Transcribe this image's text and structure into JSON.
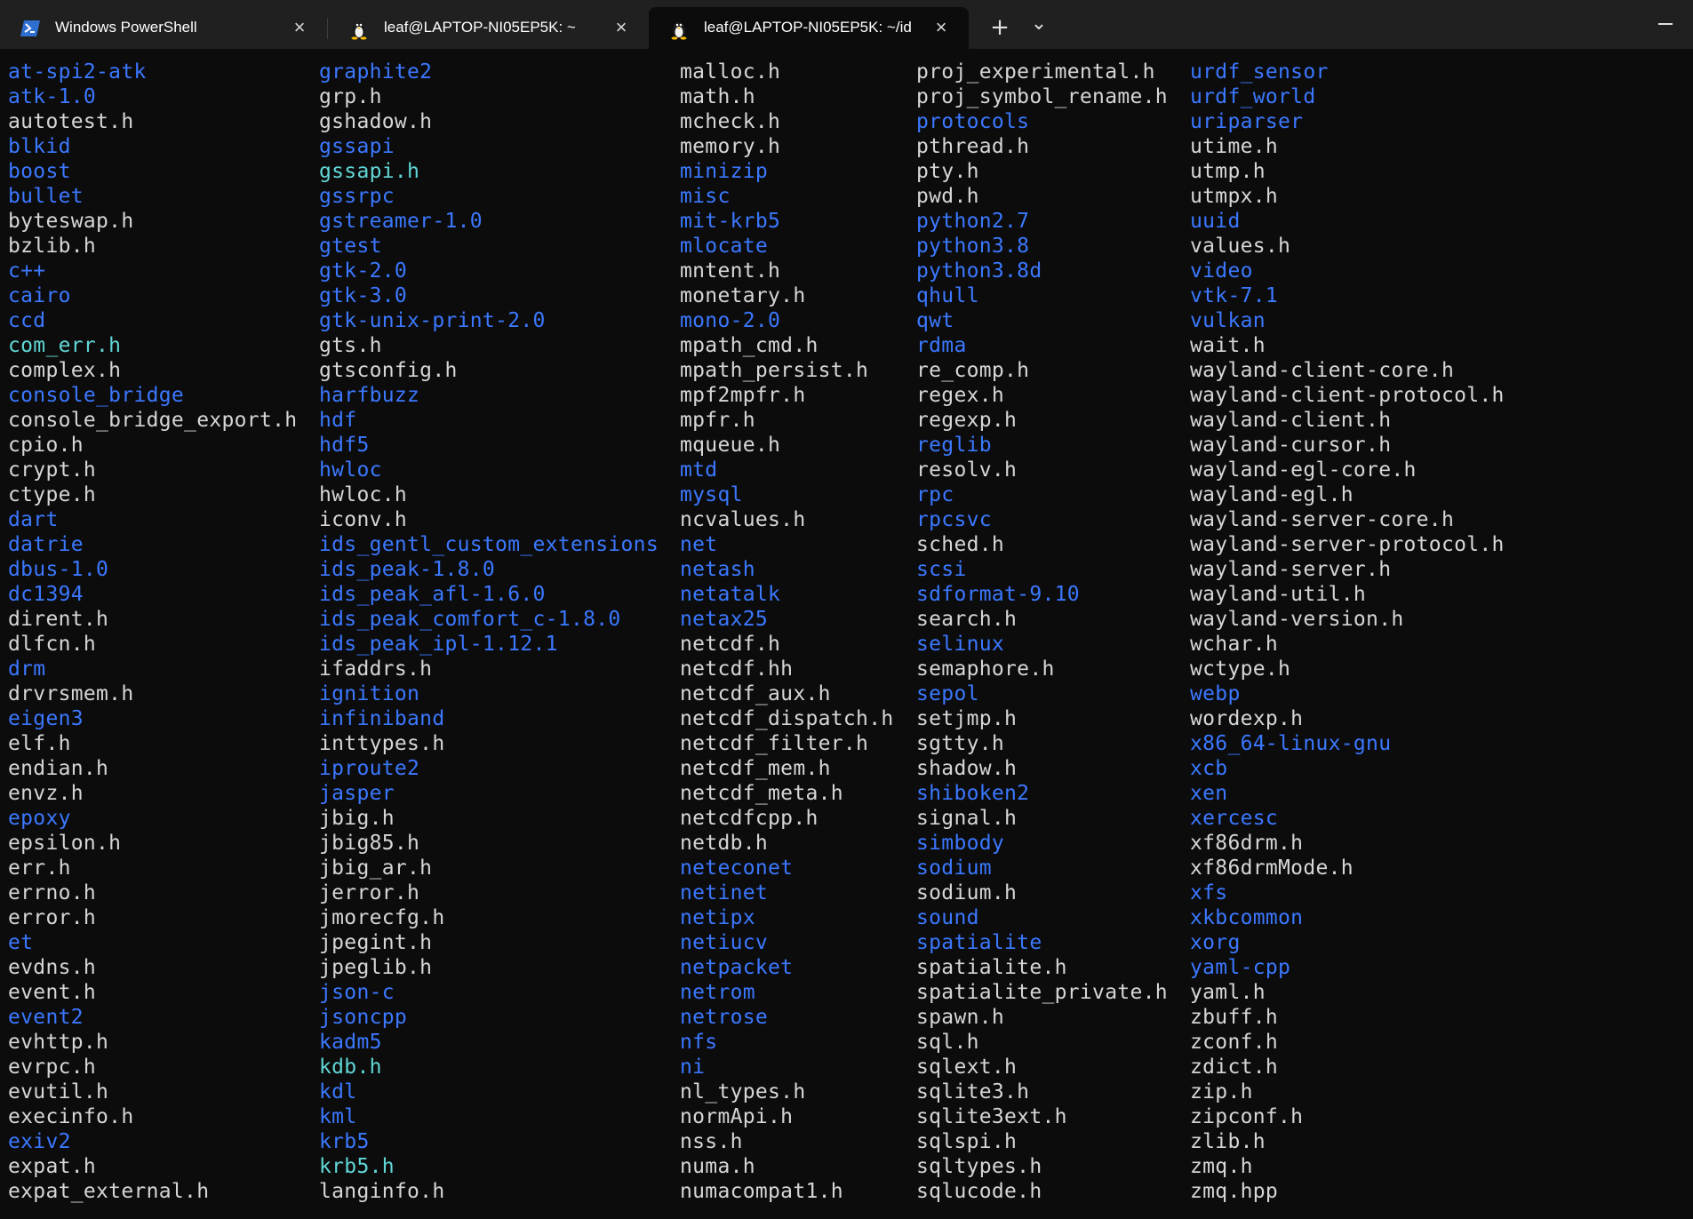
{
  "colors": {
    "file": "#d6d6d6",
    "directory": "#3b78ff",
    "cyan": "#61d6d6",
    "background": "#0c0c0c",
    "titlebar": "#202020"
  },
  "tabs": [
    {
      "title": "Windows PowerShell",
      "icon": "powershell-icon",
      "active": false
    },
    {
      "title": "leaf@LAPTOP-NI05EP5K: ~",
      "icon": "linux-penguin-icon",
      "active": false
    },
    {
      "title": "leaf@LAPTOP-NI05EP5K: ~/id",
      "icon": "linux-penguin-icon",
      "active": true
    }
  ],
  "titlebar": {
    "new_tab": "+",
    "dropdown": "⌄"
  },
  "columns": [
    [
      {
        "n": "at-spi2-atk",
        "t": "d"
      },
      {
        "n": "atk-1.0",
        "t": "d"
      },
      {
        "n": "autotest.h",
        "t": "f"
      },
      {
        "n": "blkid",
        "t": "d"
      },
      {
        "n": "boost",
        "t": "d"
      },
      {
        "n": "bullet",
        "t": "d"
      },
      {
        "n": "byteswap.h",
        "t": "f"
      },
      {
        "n": "bzlib.h",
        "t": "f"
      },
      {
        "n": "c++",
        "t": "d"
      },
      {
        "n": "cairo",
        "t": "d"
      },
      {
        "n": "ccd",
        "t": "d"
      },
      {
        "n": "com_err.h",
        "t": "c"
      },
      {
        "n": "complex.h",
        "t": "f"
      },
      {
        "n": "console_bridge",
        "t": "d"
      },
      {
        "n": "console_bridge_export.h",
        "t": "f"
      },
      {
        "n": "cpio.h",
        "t": "f"
      },
      {
        "n": "crypt.h",
        "t": "f"
      },
      {
        "n": "ctype.h",
        "t": "f"
      },
      {
        "n": "dart",
        "t": "d"
      },
      {
        "n": "datrie",
        "t": "d"
      },
      {
        "n": "dbus-1.0",
        "t": "d"
      },
      {
        "n": "dc1394",
        "t": "d"
      },
      {
        "n": "dirent.h",
        "t": "f"
      },
      {
        "n": "dlfcn.h",
        "t": "f"
      },
      {
        "n": "drm",
        "t": "d"
      },
      {
        "n": "drvrsmem.h",
        "t": "f"
      },
      {
        "n": "eigen3",
        "t": "d"
      },
      {
        "n": "elf.h",
        "t": "f"
      },
      {
        "n": "endian.h",
        "t": "f"
      },
      {
        "n": "envz.h",
        "t": "f"
      },
      {
        "n": "epoxy",
        "t": "d"
      },
      {
        "n": "epsilon.h",
        "t": "f"
      },
      {
        "n": "err.h",
        "t": "f"
      },
      {
        "n": "errno.h",
        "t": "f"
      },
      {
        "n": "error.h",
        "t": "f"
      },
      {
        "n": "et",
        "t": "d"
      },
      {
        "n": "evdns.h",
        "t": "f"
      },
      {
        "n": "event.h",
        "t": "f"
      },
      {
        "n": "event2",
        "t": "d"
      },
      {
        "n": "evhttp.h",
        "t": "f"
      },
      {
        "n": "evrpc.h",
        "t": "f"
      },
      {
        "n": "evutil.h",
        "t": "f"
      },
      {
        "n": "execinfo.h",
        "t": "f"
      },
      {
        "n": "exiv2",
        "t": "d"
      },
      {
        "n": "expat.h",
        "t": "f"
      },
      {
        "n": "expat_external.h",
        "t": "f"
      }
    ],
    [
      {
        "n": "graphite2",
        "t": "d"
      },
      {
        "n": "grp.h",
        "t": "f"
      },
      {
        "n": "gshadow.h",
        "t": "f"
      },
      {
        "n": "gssapi",
        "t": "d"
      },
      {
        "n": "gssapi.h",
        "t": "c"
      },
      {
        "n": "gssrpc",
        "t": "d"
      },
      {
        "n": "gstreamer-1.0",
        "t": "d"
      },
      {
        "n": "gtest",
        "t": "d"
      },
      {
        "n": "gtk-2.0",
        "t": "d"
      },
      {
        "n": "gtk-3.0",
        "t": "d"
      },
      {
        "n": "gtk-unix-print-2.0",
        "t": "d"
      },
      {
        "n": "gts.h",
        "t": "f"
      },
      {
        "n": "gtsconfig.h",
        "t": "f"
      },
      {
        "n": "harfbuzz",
        "t": "d"
      },
      {
        "n": "hdf",
        "t": "d"
      },
      {
        "n": "hdf5",
        "t": "d"
      },
      {
        "n": "hwloc",
        "t": "d"
      },
      {
        "n": "hwloc.h",
        "t": "f"
      },
      {
        "n": "iconv.h",
        "t": "f"
      },
      {
        "n": "ids_gentl_custom_extensions",
        "t": "d"
      },
      {
        "n": "ids_peak-1.8.0",
        "t": "d"
      },
      {
        "n": "ids_peak_afl-1.6.0",
        "t": "d"
      },
      {
        "n": "ids_peak_comfort_c-1.8.0",
        "t": "d"
      },
      {
        "n": "ids_peak_ipl-1.12.1",
        "t": "d"
      },
      {
        "n": "ifaddrs.h",
        "t": "f"
      },
      {
        "n": "ignition",
        "t": "d"
      },
      {
        "n": "infiniband",
        "t": "d"
      },
      {
        "n": "inttypes.h",
        "t": "f"
      },
      {
        "n": "iproute2",
        "t": "d"
      },
      {
        "n": "jasper",
        "t": "d"
      },
      {
        "n": "jbig.h",
        "t": "f"
      },
      {
        "n": "jbig85.h",
        "t": "f"
      },
      {
        "n": "jbig_ar.h",
        "t": "f"
      },
      {
        "n": "jerror.h",
        "t": "f"
      },
      {
        "n": "jmorecfg.h",
        "t": "f"
      },
      {
        "n": "jpegint.h",
        "t": "f"
      },
      {
        "n": "jpeglib.h",
        "t": "f"
      },
      {
        "n": "json-c",
        "t": "d"
      },
      {
        "n": "jsoncpp",
        "t": "d"
      },
      {
        "n": "kadm5",
        "t": "d"
      },
      {
        "n": "kdb.h",
        "t": "c"
      },
      {
        "n": "kdl",
        "t": "d"
      },
      {
        "n": "kml",
        "t": "d"
      },
      {
        "n": "krb5",
        "t": "d"
      },
      {
        "n": "krb5.h",
        "t": "c"
      },
      {
        "n": "langinfo.h",
        "t": "f"
      }
    ],
    [
      {
        "n": "malloc.h",
        "t": "f"
      },
      {
        "n": "math.h",
        "t": "f"
      },
      {
        "n": "mcheck.h",
        "t": "f"
      },
      {
        "n": "memory.h",
        "t": "f"
      },
      {
        "n": "minizip",
        "t": "d"
      },
      {
        "n": "misc",
        "t": "d"
      },
      {
        "n": "mit-krb5",
        "t": "d"
      },
      {
        "n": "mlocate",
        "t": "d"
      },
      {
        "n": "mntent.h",
        "t": "f"
      },
      {
        "n": "monetary.h",
        "t": "f"
      },
      {
        "n": "mono-2.0",
        "t": "d"
      },
      {
        "n": "mpath_cmd.h",
        "t": "f"
      },
      {
        "n": "mpath_persist.h",
        "t": "f"
      },
      {
        "n": "mpf2mpfr.h",
        "t": "f"
      },
      {
        "n": "mpfr.h",
        "t": "f"
      },
      {
        "n": "mqueue.h",
        "t": "f"
      },
      {
        "n": "mtd",
        "t": "d"
      },
      {
        "n": "mysql",
        "t": "d"
      },
      {
        "n": "ncvalues.h",
        "t": "f"
      },
      {
        "n": "net",
        "t": "d"
      },
      {
        "n": "netash",
        "t": "d"
      },
      {
        "n": "netatalk",
        "t": "d"
      },
      {
        "n": "netax25",
        "t": "d"
      },
      {
        "n": "netcdf.h",
        "t": "f"
      },
      {
        "n": "netcdf.hh",
        "t": "f"
      },
      {
        "n": "netcdf_aux.h",
        "t": "f"
      },
      {
        "n": "netcdf_dispatch.h",
        "t": "f"
      },
      {
        "n": "netcdf_filter.h",
        "t": "f"
      },
      {
        "n": "netcdf_mem.h",
        "t": "f"
      },
      {
        "n": "netcdf_meta.h",
        "t": "f"
      },
      {
        "n": "netcdfcpp.h",
        "t": "f"
      },
      {
        "n": "netdb.h",
        "t": "f"
      },
      {
        "n": "neteconet",
        "t": "d"
      },
      {
        "n": "netinet",
        "t": "d"
      },
      {
        "n": "netipx",
        "t": "d"
      },
      {
        "n": "netiucv",
        "t": "d"
      },
      {
        "n": "netpacket",
        "t": "d"
      },
      {
        "n": "netrom",
        "t": "d"
      },
      {
        "n": "netrose",
        "t": "d"
      },
      {
        "n": "nfs",
        "t": "d"
      },
      {
        "n": "ni",
        "t": "d"
      },
      {
        "n": "nl_types.h",
        "t": "f"
      },
      {
        "n": "normApi.h",
        "t": "f"
      },
      {
        "n": "nss.h",
        "t": "f"
      },
      {
        "n": "numa.h",
        "t": "f"
      },
      {
        "n": "numacompat1.h",
        "t": "f"
      }
    ],
    [
      {
        "n": "proj_experimental.h",
        "t": "f"
      },
      {
        "n": "proj_symbol_rename.h",
        "t": "f"
      },
      {
        "n": "protocols",
        "t": "d"
      },
      {
        "n": "pthread.h",
        "t": "f"
      },
      {
        "n": "pty.h",
        "t": "f"
      },
      {
        "n": "pwd.h",
        "t": "f"
      },
      {
        "n": "python2.7",
        "t": "d"
      },
      {
        "n": "python3.8",
        "t": "d"
      },
      {
        "n": "python3.8d",
        "t": "d"
      },
      {
        "n": "qhull",
        "t": "d"
      },
      {
        "n": "qwt",
        "t": "d"
      },
      {
        "n": "rdma",
        "t": "d"
      },
      {
        "n": "re_comp.h",
        "t": "f"
      },
      {
        "n": "regex.h",
        "t": "f"
      },
      {
        "n": "regexp.h",
        "t": "f"
      },
      {
        "n": "reglib",
        "t": "d"
      },
      {
        "n": "resolv.h",
        "t": "f"
      },
      {
        "n": "rpc",
        "t": "d"
      },
      {
        "n": "rpcsvc",
        "t": "d"
      },
      {
        "n": "sched.h",
        "t": "f"
      },
      {
        "n": "scsi",
        "t": "d"
      },
      {
        "n": "sdformat-9.10",
        "t": "d"
      },
      {
        "n": "search.h",
        "t": "f"
      },
      {
        "n": "selinux",
        "t": "d"
      },
      {
        "n": "semaphore.h",
        "t": "f"
      },
      {
        "n": "sepol",
        "t": "d"
      },
      {
        "n": "setjmp.h",
        "t": "f"
      },
      {
        "n": "sgtty.h",
        "t": "f"
      },
      {
        "n": "shadow.h",
        "t": "f"
      },
      {
        "n": "shiboken2",
        "t": "d"
      },
      {
        "n": "signal.h",
        "t": "f"
      },
      {
        "n": "simbody",
        "t": "d"
      },
      {
        "n": "sodium",
        "t": "d"
      },
      {
        "n": "sodium.h",
        "t": "f"
      },
      {
        "n": "sound",
        "t": "d"
      },
      {
        "n": "spatialite",
        "t": "d"
      },
      {
        "n": "spatialite.h",
        "t": "f"
      },
      {
        "n": "spatialite_private.h",
        "t": "f"
      },
      {
        "n": "spawn.h",
        "t": "f"
      },
      {
        "n": "sql.h",
        "t": "f"
      },
      {
        "n": "sqlext.h",
        "t": "f"
      },
      {
        "n": "sqlite3.h",
        "t": "f"
      },
      {
        "n": "sqlite3ext.h",
        "t": "f"
      },
      {
        "n": "sqlspi.h",
        "t": "f"
      },
      {
        "n": "sqltypes.h",
        "t": "f"
      },
      {
        "n": "sqlucode.h",
        "t": "f"
      }
    ],
    [
      {
        "n": "urdf_sensor",
        "t": "d"
      },
      {
        "n": "urdf_world",
        "t": "d"
      },
      {
        "n": "uriparser",
        "t": "d"
      },
      {
        "n": "utime.h",
        "t": "f"
      },
      {
        "n": "utmp.h",
        "t": "f"
      },
      {
        "n": "utmpx.h",
        "t": "f"
      },
      {
        "n": "uuid",
        "t": "d"
      },
      {
        "n": "values.h",
        "t": "f"
      },
      {
        "n": "video",
        "t": "d"
      },
      {
        "n": "vtk-7.1",
        "t": "d"
      },
      {
        "n": "vulkan",
        "t": "d"
      },
      {
        "n": "wait.h",
        "t": "f"
      },
      {
        "n": "wayland-client-core.h",
        "t": "f"
      },
      {
        "n": "wayland-client-protocol.h",
        "t": "f"
      },
      {
        "n": "wayland-client.h",
        "t": "f"
      },
      {
        "n": "wayland-cursor.h",
        "t": "f"
      },
      {
        "n": "wayland-egl-core.h",
        "t": "f"
      },
      {
        "n": "wayland-egl.h",
        "t": "f"
      },
      {
        "n": "wayland-server-core.h",
        "t": "f"
      },
      {
        "n": "wayland-server-protocol.h",
        "t": "f"
      },
      {
        "n": "wayland-server.h",
        "t": "f"
      },
      {
        "n": "wayland-util.h",
        "t": "f"
      },
      {
        "n": "wayland-version.h",
        "t": "f"
      },
      {
        "n": "wchar.h",
        "t": "f"
      },
      {
        "n": "wctype.h",
        "t": "f"
      },
      {
        "n": "webp",
        "t": "d"
      },
      {
        "n": "wordexp.h",
        "t": "f"
      },
      {
        "n": "x86_64-linux-gnu",
        "t": "d"
      },
      {
        "n": "xcb",
        "t": "d"
      },
      {
        "n": "xen",
        "t": "d"
      },
      {
        "n": "xercesc",
        "t": "d"
      },
      {
        "n": "xf86drm.h",
        "t": "f"
      },
      {
        "n": "xf86drmMode.h",
        "t": "f"
      },
      {
        "n": "xfs",
        "t": "d"
      },
      {
        "n": "xkbcommon",
        "t": "d"
      },
      {
        "n": "xorg",
        "t": "d"
      },
      {
        "n": "yaml-cpp",
        "t": "d"
      },
      {
        "n": "yaml.h",
        "t": "f"
      },
      {
        "n": "zbuff.h",
        "t": "f"
      },
      {
        "n": "zconf.h",
        "t": "f"
      },
      {
        "n": "zdict.h",
        "t": "f"
      },
      {
        "n": "zip.h",
        "t": "f"
      },
      {
        "n": "zipconf.h",
        "t": "f"
      },
      {
        "n": "zlib.h",
        "t": "f"
      },
      {
        "n": "zmq.h",
        "t": "f"
      },
      {
        "n": "zmq.hpp",
        "t": "f"
      }
    ]
  ]
}
